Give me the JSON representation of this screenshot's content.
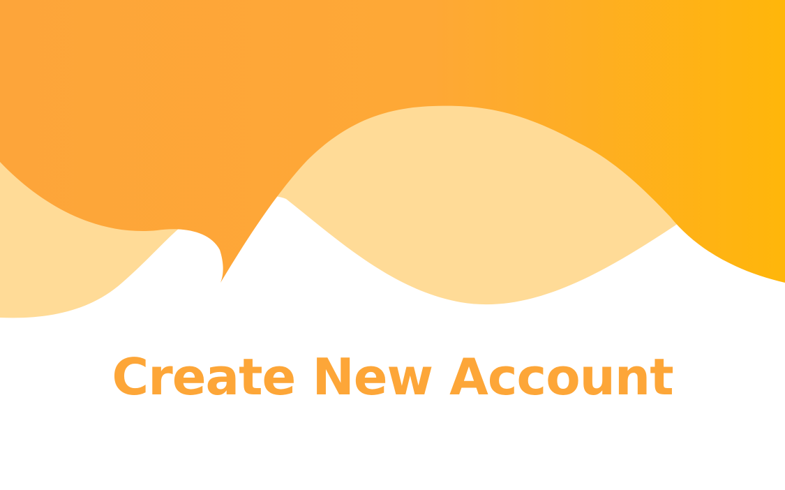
{
  "page": {
    "title": "Create New Account"
  },
  "colors": {
    "background": "#ffffff",
    "title": "#FDA638",
    "wave_light": "#FFDB97",
    "wave_dark_start": "#FDA53A",
    "wave_dark_end": "#FFB60A"
  }
}
